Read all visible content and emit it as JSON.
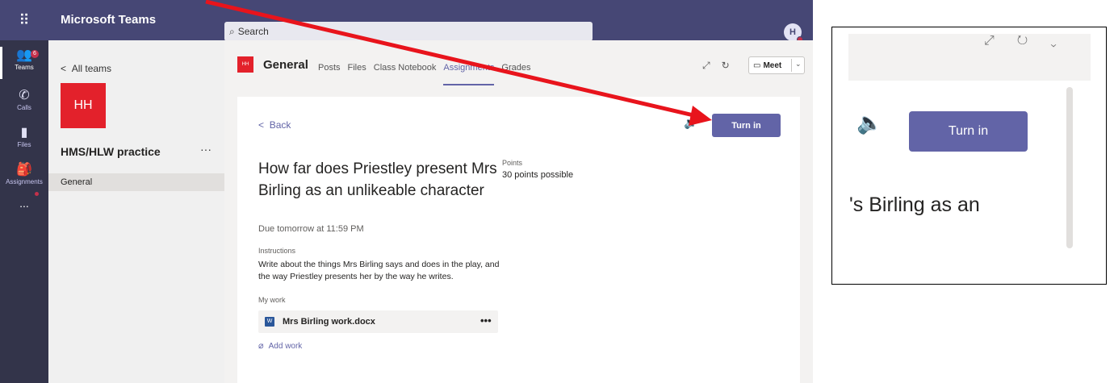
{
  "app": {
    "name": "Microsoft Teams"
  },
  "search": {
    "placeholder": "Search"
  },
  "avatar": {
    "initials": "H"
  },
  "rail": {
    "items": [
      {
        "icon": "teams-icon",
        "label": "Teams"
      },
      {
        "icon": "calls-icon",
        "label": "Calls"
      },
      {
        "icon": "files-icon",
        "label": "Files"
      },
      {
        "icon": "assignments-icon",
        "label": "Assignments"
      },
      {
        "icon": "more-icon",
        "label": "..."
      }
    ]
  },
  "left_panel": {
    "back_label": "All teams",
    "team_tile": "HH",
    "team_name": "HMS/HLW practice",
    "more": "···",
    "channel": "General"
  },
  "header": {
    "tile": "HH",
    "channel_title": "General",
    "tabs": [
      "Posts",
      "Files",
      "Class Notebook",
      "Assignments",
      "Grades"
    ],
    "active_tab": "Assignments",
    "meet_label": "Meet"
  },
  "assignment": {
    "back_label": "Back",
    "turn_in_label": "Turn in",
    "title": "How far does Priestley present Mrs Birling as an unlikeable character",
    "due": "Due tomorrow at 11:59 PM",
    "points_label": "Points",
    "points_value": "30 points possible",
    "instructions_label": "Instructions",
    "instructions": "Write about the things Mrs Birling says and does in the play, and the way Priestley presents her by the way he writes.",
    "my_work_label": "My work",
    "file_name": "Mrs Birling work.docx",
    "file_more": "•••",
    "add_work_label": "Add work"
  },
  "zoom": {
    "turn_in_label": "Turn in",
    "text_fragment": "'s Birling as an"
  },
  "colors": {
    "brand": "#464775",
    "accent": "#6264a7",
    "team_tile": "#e3212b",
    "arrow": "#e8141c"
  }
}
